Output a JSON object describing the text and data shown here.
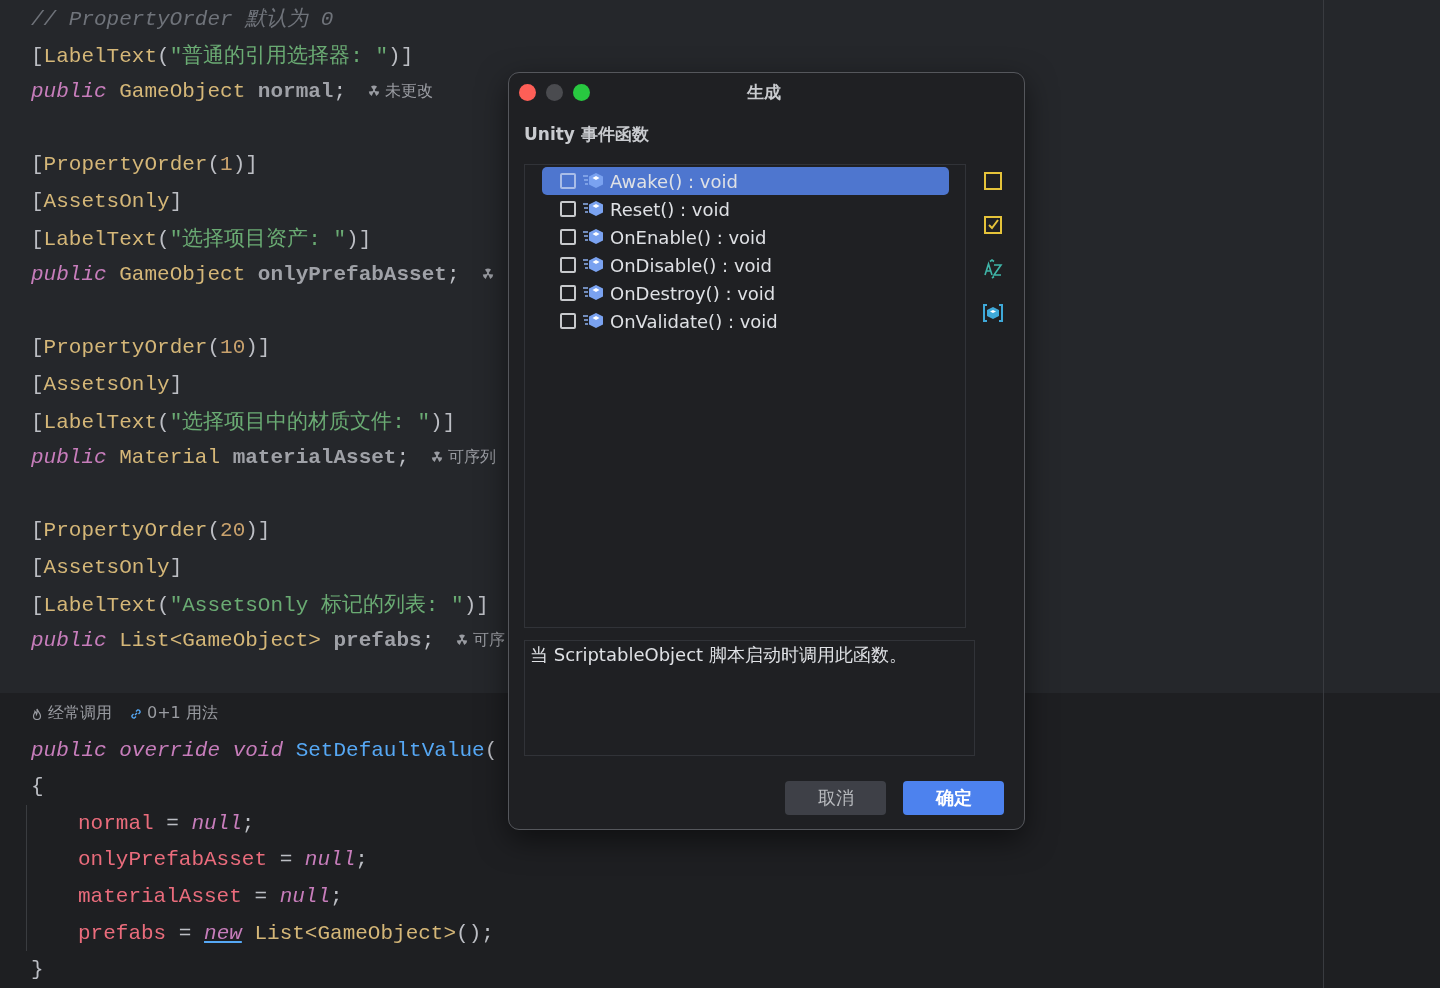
{
  "editor": {
    "lines": [
      {
        "kind": "code",
        "tokens": [
          {
            "kind": "comment",
            "text": "// PropertyOrder 默认为 0"
          }
        ]
      },
      {
        "kind": "code",
        "tokens": [
          {
            "kind": "punct",
            "text": "["
          },
          {
            "kind": "attr",
            "text": "LabelText"
          },
          {
            "kind": "punct",
            "text": "("
          },
          {
            "kind": "string",
            "text": "\"普通的引用选择器: \""
          },
          {
            "kind": "punct",
            "text": ")]"
          }
        ]
      },
      {
        "kind": "code",
        "tokens": [
          {
            "kind": "keyword",
            "text": "public"
          },
          {
            "kind": "type",
            "text": " GameObject"
          },
          {
            "kind": "field",
            "text": " normal"
          },
          {
            "kind": "punct",
            "text": ";"
          }
        ],
        "inlay": {
          "kind": "radiation",
          "text": "未更改"
        }
      },
      {
        "kind": "blank"
      },
      {
        "kind": "code",
        "tokens": [
          {
            "kind": "punct",
            "text": "["
          },
          {
            "kind": "attr",
            "text": "PropertyOrder"
          },
          {
            "kind": "punct",
            "text": "("
          },
          {
            "kind": "number",
            "text": "1"
          },
          {
            "kind": "punct",
            "text": ")]"
          }
        ]
      },
      {
        "kind": "code",
        "tokens": [
          {
            "kind": "punct",
            "text": "["
          },
          {
            "kind": "attr",
            "text": "AssetsOnly"
          },
          {
            "kind": "punct",
            "text": "]"
          }
        ]
      },
      {
        "kind": "code",
        "tokens": [
          {
            "kind": "punct",
            "text": "["
          },
          {
            "kind": "attr",
            "text": "LabelText"
          },
          {
            "kind": "punct",
            "text": "("
          },
          {
            "kind": "string",
            "text": "\"选择项目资产: \""
          },
          {
            "kind": "punct",
            "text": ")]"
          }
        ]
      },
      {
        "kind": "code",
        "tokens": [
          {
            "kind": "keyword",
            "text": "public"
          },
          {
            "kind": "type",
            "text": " GameObject"
          },
          {
            "kind": "field",
            "text": " onlyPrefabAsset"
          },
          {
            "kind": "punct",
            "text": ";"
          }
        ],
        "inlay": {
          "kind": "radiation"
        }
      },
      {
        "kind": "blank"
      },
      {
        "kind": "code",
        "tokens": [
          {
            "kind": "punct",
            "text": "["
          },
          {
            "kind": "attr",
            "text": "PropertyOrder"
          },
          {
            "kind": "punct",
            "text": "("
          },
          {
            "kind": "number",
            "text": "10"
          },
          {
            "kind": "punct",
            "text": ")]"
          }
        ]
      },
      {
        "kind": "code",
        "tokens": [
          {
            "kind": "punct",
            "text": "["
          },
          {
            "kind": "attr",
            "text": "AssetsOnly"
          },
          {
            "kind": "punct",
            "text": "]"
          }
        ]
      },
      {
        "kind": "code",
        "tokens": [
          {
            "kind": "punct",
            "text": "["
          },
          {
            "kind": "attr",
            "text": "LabelText"
          },
          {
            "kind": "punct",
            "text": "("
          },
          {
            "kind": "string",
            "text": "\"选择项目中的材质文件: \""
          },
          {
            "kind": "punct",
            "text": ")]"
          }
        ]
      },
      {
        "kind": "code",
        "tokens": [
          {
            "kind": "keyword",
            "text": "public"
          },
          {
            "kind": "type",
            "text": " Material"
          },
          {
            "kind": "field",
            "text": " materialAsset"
          },
          {
            "kind": "punct",
            "text": ";"
          }
        ],
        "inlay": {
          "kind": "radiation",
          "text": "可序列"
        }
      },
      {
        "kind": "blank"
      },
      {
        "kind": "code",
        "tokens": [
          {
            "kind": "punct",
            "text": "["
          },
          {
            "kind": "attr",
            "text": "PropertyOrder"
          },
          {
            "kind": "punct",
            "text": "("
          },
          {
            "kind": "number",
            "text": "20"
          },
          {
            "kind": "punct",
            "text": ")]"
          }
        ]
      },
      {
        "kind": "code",
        "tokens": [
          {
            "kind": "punct",
            "text": "["
          },
          {
            "kind": "attr",
            "text": "AssetsOnly"
          },
          {
            "kind": "punct",
            "text": "]"
          }
        ]
      },
      {
        "kind": "code",
        "tokens": [
          {
            "kind": "punct",
            "text": "["
          },
          {
            "kind": "attr",
            "text": "LabelText"
          },
          {
            "kind": "punct",
            "text": "("
          },
          {
            "kind": "string",
            "text": "\"AssetsOnly 标记的列表: \""
          },
          {
            "kind": "punct",
            "text": ")]"
          }
        ]
      },
      {
        "kind": "code",
        "tokens": [
          {
            "kind": "keyword",
            "text": "public"
          },
          {
            "kind": "type",
            "text": " List<GameObject>"
          },
          {
            "kind": "field",
            "text": " prefabs"
          },
          {
            "kind": "punct",
            "text": ";"
          }
        ],
        "inlay": {
          "kind": "radiation",
          "text": "可序"
        }
      },
      {
        "kind": "blank"
      },
      {
        "kind": "hints",
        "items": [
          {
            "kind": "flame",
            "text": "经常调用"
          },
          {
            "kind": "link",
            "text": "0+1 用法"
          }
        ]
      },
      {
        "kind": "code",
        "tokens": [
          {
            "kind": "keyword",
            "text": "public override void"
          },
          {
            "kind": "method",
            "text": " SetDefaultValue"
          },
          {
            "kind": "punct",
            "text": "("
          }
        ]
      },
      {
        "kind": "code",
        "tokens": [
          {
            "kind": "punct",
            "text": "{"
          }
        ]
      },
      {
        "kind": "code",
        "indent": true,
        "tokens": [
          {
            "kind": "local",
            "text": "normal"
          },
          {
            "kind": "punct",
            "text": " = "
          },
          {
            "kind": "keyword",
            "text": "null"
          },
          {
            "kind": "punct",
            "text": ";"
          }
        ]
      },
      {
        "kind": "code",
        "indent": true,
        "tokens": [
          {
            "kind": "local",
            "text": "onlyPrefabAsset"
          },
          {
            "kind": "punct",
            "text": " = "
          },
          {
            "kind": "keyword",
            "text": "null"
          },
          {
            "kind": "punct",
            "text": ";"
          }
        ]
      },
      {
        "kind": "code",
        "indent": true,
        "tokens": [
          {
            "kind": "local",
            "text": "materialAsset"
          },
          {
            "kind": "punct",
            "text": " = "
          },
          {
            "kind": "keyword",
            "text": "null"
          },
          {
            "kind": "punct",
            "text": ";"
          }
        ]
      },
      {
        "kind": "code",
        "indent": true,
        "tokens": [
          {
            "kind": "local",
            "text": "prefabs"
          },
          {
            "kind": "punct",
            "text": " = "
          },
          {
            "kind": "new",
            "text": "new"
          },
          {
            "kind": "type",
            "text": " List<GameObject>"
          },
          {
            "kind": "punct",
            "text": "();"
          }
        ]
      },
      {
        "kind": "code",
        "tokens": [
          {
            "kind": "punct",
            "text": "}"
          }
        ]
      }
    ]
  },
  "dialog": {
    "title": "生成",
    "section": "Unity 事件函数",
    "items": [
      {
        "label": "Awake() : void",
        "checked": false,
        "selected": true
      },
      {
        "label": "Reset() : void",
        "checked": false,
        "selected": false
      },
      {
        "label": "OnEnable() : void",
        "checked": false,
        "selected": false
      },
      {
        "label": "OnDisable() : void",
        "checked": false,
        "selected": false
      },
      {
        "label": "OnDestroy() : void",
        "checked": false,
        "selected": false
      },
      {
        "label": "OnValidate() : void",
        "checked": false,
        "selected": false
      }
    ],
    "tools": [
      {
        "kind": "uncheck-all"
      },
      {
        "kind": "check-all"
      },
      {
        "kind": "sort"
      },
      {
        "kind": "unity"
      }
    ],
    "description": "当 ScriptableObject 脚本启动时调用此函数。",
    "buttons": [
      {
        "label": "取消",
        "kind": "secondary"
      },
      {
        "label": "确定",
        "kind": "primary"
      }
    ]
  }
}
